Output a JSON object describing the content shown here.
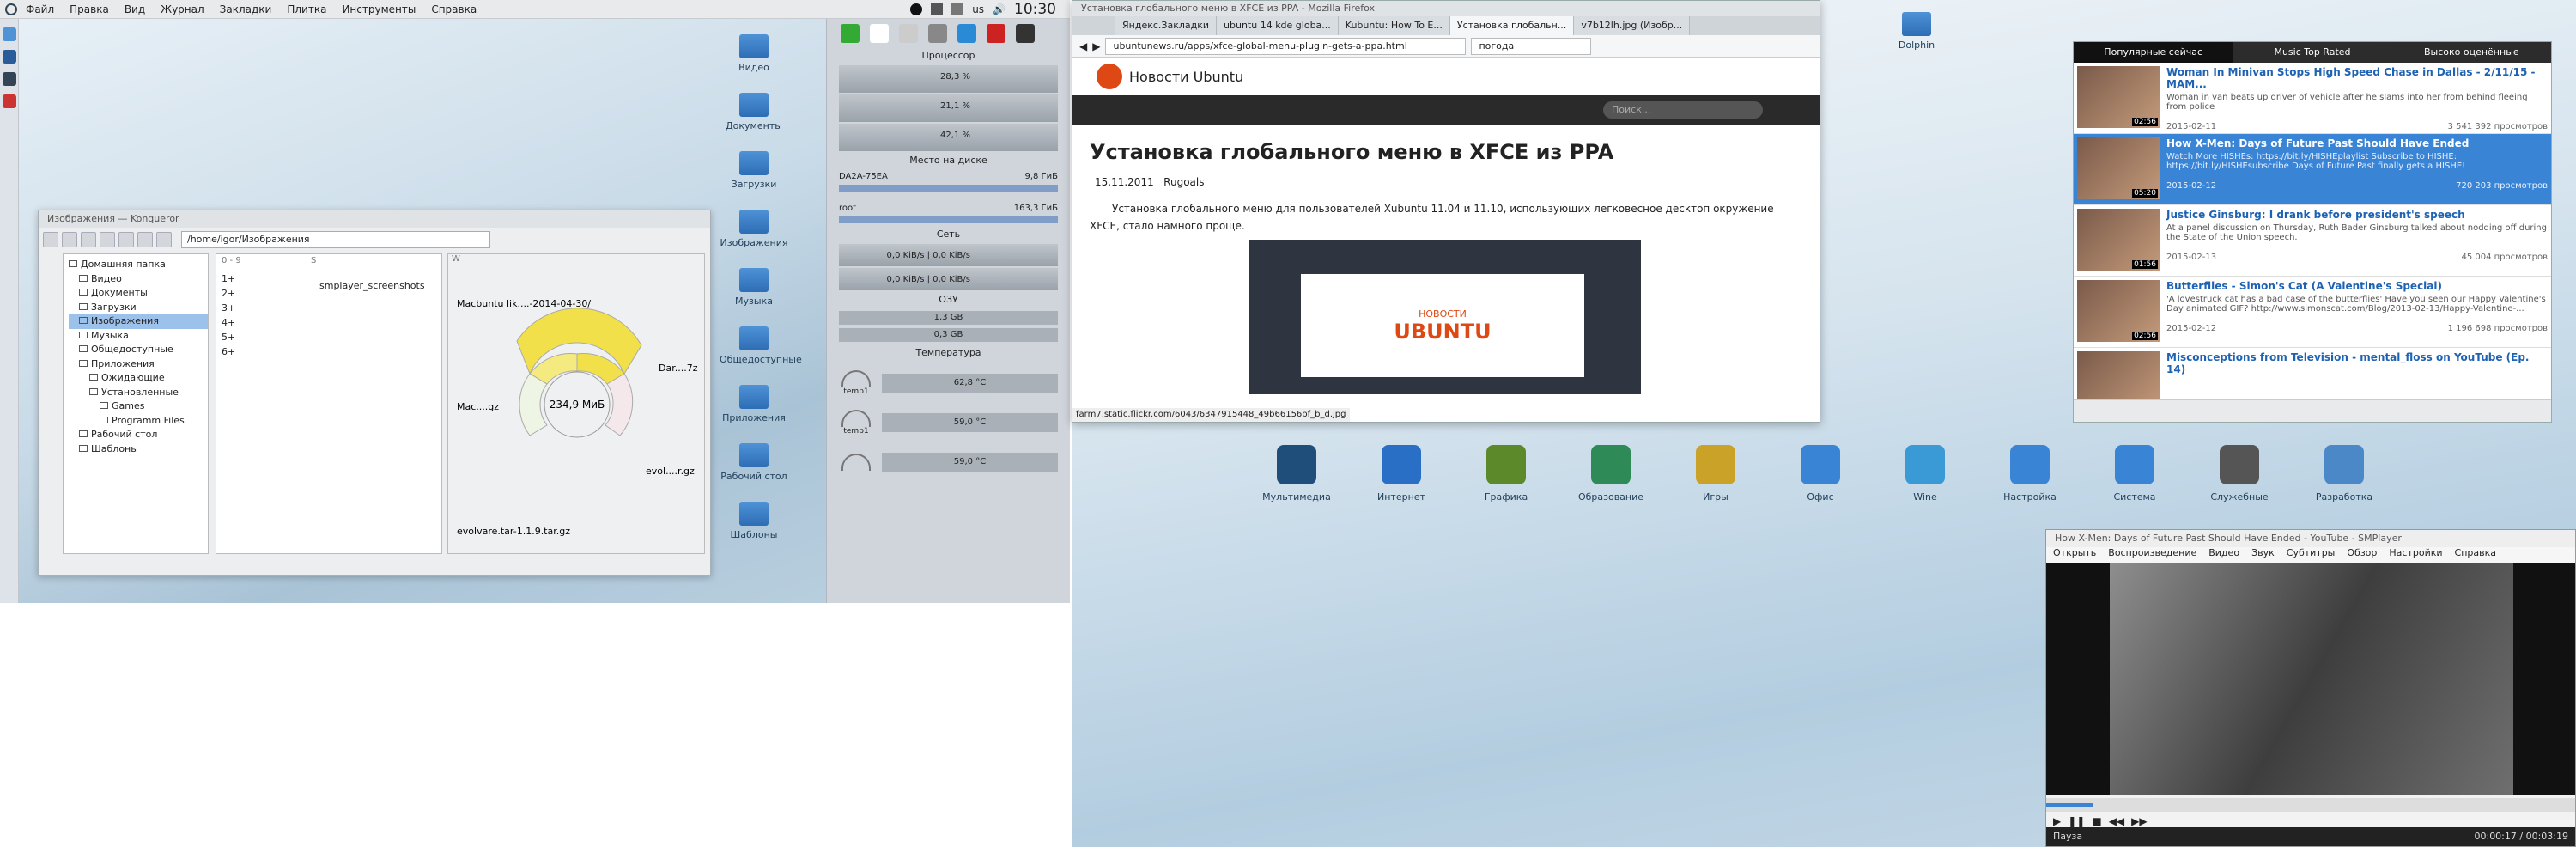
{
  "topbar": {
    "menu": [
      "Файл",
      "Правка",
      "Вид",
      "Журнал",
      "Закладки",
      "Плитка",
      "Инструменты",
      "Справка"
    ],
    "lang": "us",
    "clock": "10:30"
  },
  "desktop_left": [
    "Видео",
    "Документы",
    "Загрузки",
    "Изображения",
    "Музыка",
    "Общедоступные",
    "Приложения",
    "Рабочий стол",
    "Шаблоны"
  ],
  "desktop_right": [
    "Dolphin"
  ],
  "filemgr": {
    "title": "Изображения — Konqueror",
    "path": "/home/igor/Изображения",
    "tree": [
      "Домашняя папка",
      "Видео",
      "Документы",
      "Загрузки",
      "Изображения",
      "Музыка",
      "Общедоступные",
      "Приложения",
      "Ожидающие",
      "Установленные",
      "Games",
      "Programm Files",
      "Рабочий стол",
      "Шаблоны"
    ],
    "col_headers": [
      "0 - 9",
      "S",
      "W"
    ],
    "col1": [
      "1+",
      "2+",
      "3+",
      "4+",
      "5+",
      "6+"
    ],
    "col2": [
      "smplayer_screenshots"
    ],
    "sunburst": {
      "center": "234,9 МиБ",
      "labels": [
        "Macbuntu lik....-2014-04-30/",
        "Dar....7z",
        "Mac....gz",
        "evol....r.gz",
        "evolvare.tar-1.1.9.tar.gz"
      ]
    }
  },
  "monitor": {
    "sections": [
      "Процессор",
      "Место на диске",
      "Сеть",
      "ОЗУ",
      "Температура"
    ],
    "cpu": [
      "28,3 %",
      "21,1 %",
      "42,1 %"
    ],
    "disks": [
      {
        "name": "DA2A-75EA",
        "size": "9,8 ГиБ"
      },
      {
        "name": "root",
        "size": "163,3 ГиБ"
      }
    ],
    "net": [
      "0,0 KiB/s | 0,0 KiB/s",
      "0,0 KiB/s | 0,0 KiB/s"
    ],
    "ram": [
      "1,3 GB",
      "0,3 GB"
    ],
    "temps": [
      {
        "name": "temp1",
        "val": "62,8 °C"
      },
      {
        "name": "temp1",
        "val": "59,0 °C"
      },
      {
        "name": "",
        "val": "59,0 °C"
      }
    ]
  },
  "firefox": {
    "title": "Установка глобального меню в XFCE из PPA - Mozilla Firefox",
    "tabs": [
      "Яндекс.Закладки",
      "ubuntu 14 kde globa...",
      "Kubuntu: How To E...",
      "Установка глобальн...",
      "v7b12lh.jpg (Изобр..."
    ],
    "url": "ubuntunews.ru/apps/xfce-global-menu-plugin-gets-a-ppa.html",
    "search": "погода",
    "site": "Новости Ubuntu",
    "search_ph": "Поиск...",
    "heading": "Установка глобального меню в XFCE из PPA",
    "date": "15.11.2011",
    "author": "Rugoals",
    "body": "Установка глобального меню для пользователей Xubuntu 11.04 и 11.10, использующих легковесное десктоп окружение XFCE, стало намного проще.",
    "status": "farm7.static.flickr.com/6043/6347915448_49b66156bf_b_d.jpg",
    "logo": "UBUNTU",
    "logo_sub": "НОВОСТИ"
  },
  "launcher": [
    "Мультимедиа",
    "Интернет",
    "Графика",
    "Образование",
    "Игры",
    "Офис",
    "Wine",
    "Настройка",
    "Система",
    "Служебные",
    "Разработка"
  ],
  "youtube": {
    "tabs": [
      "Популярные сейчас",
      "Music Top Rated",
      "Высоко оценённые"
    ],
    "items": [
      {
        "title": "Woman In Minivan Stops High Speed Chase in Dallas - 2/11/15 - MAM...",
        "desc": "Woman in van beats up driver of vehicle after he slams into her from behind fleeing from police",
        "date": "2015-02-11",
        "views": "3 541 392 просмотров",
        "dur": "02:56"
      },
      {
        "title": "How X-Men: Days of Future Past Should Have Ended",
        "desc": "Watch More HISHEs: https://bit.ly/HISHEplaylist Subscribe to HISHE: https://bit.ly/HISHEsubscribe Days of Future Past finally gets a HISHE!",
        "date": "2015-02-12",
        "views": "720 203 просмотров",
        "dur": "05:20"
      },
      {
        "title": "Justice Ginsburg: I drank before president's speech",
        "desc": "At a panel discussion on Thursday, Ruth Bader Ginsburg talked about nodding off during the State of the Union speech.",
        "date": "2015-02-13",
        "views": "45 004 просмотров",
        "dur": "01:56"
      },
      {
        "title": "Butterflies - Simon's Cat (A Valentine's Special)",
        "desc": "'A lovestruck cat has a bad case of the butterflies' Have you seen our Happy Valentine's Day animated GIF? http://www.simonscat.com/Blog/2013-02-13/Happy-Valentine-...",
        "date": "2015-02-12",
        "views": "1 196 698 просмотров",
        "dur": "02:56"
      },
      {
        "title": "Misconceptions from Television - mental_floss on YouTube (Ep. 14)",
        "desc": "",
        "date": "",
        "views": "",
        "dur": ""
      }
    ]
  },
  "smplayer": {
    "title": "How X-Men: Days of Future Past Should Have Ended - YouTube - SMPlayer",
    "menu": [
      "Открыть",
      "Воспроизведение",
      "Видео",
      "Звук",
      "Субтитры",
      "Обзор",
      "Настройки",
      "Справка"
    ],
    "status": "Пауза",
    "time": "00:00:17 / 00:03:19",
    "progress": 0.09
  },
  "colors": {
    "accent": "#3a84d6",
    "sunburst": "#f2e04a",
    "ubuntu": "#dd4814"
  }
}
